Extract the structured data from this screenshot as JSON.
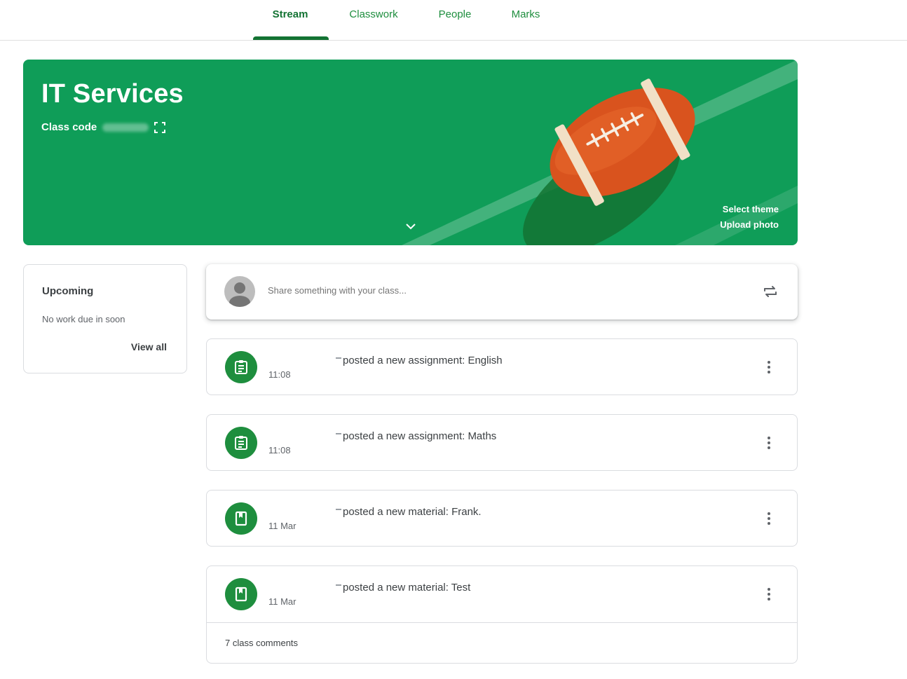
{
  "nav": {
    "tabs": [
      {
        "label": "Stream",
        "active": true
      },
      {
        "label": "Classwork",
        "active": false
      },
      {
        "label": "People",
        "active": false
      },
      {
        "label": "Marks",
        "active": false
      }
    ]
  },
  "banner": {
    "title": "IT Services",
    "class_code_label": "Class code",
    "select_theme": "Select theme",
    "upload_photo": "Upload photo",
    "color": "#0f9d58"
  },
  "upcoming": {
    "title": "Upcoming",
    "text": "No work due in soon",
    "view_all": "View all"
  },
  "share": {
    "placeholder": "Share something with your class..."
  },
  "posts": [
    {
      "title": "posted a new assignment: English",
      "time": "11:08",
      "icon": "assignment-icon"
    },
    {
      "title": "posted a new assignment: Maths",
      "time": "11:08",
      "icon": "assignment-icon"
    },
    {
      "title": "posted a new material: Frank.",
      "time": "11 Mar",
      "icon": "material-icon"
    },
    {
      "title": "posted a new material: Test",
      "time": "11 Mar",
      "icon": "material-icon",
      "comments": "7 class comments"
    }
  ],
  "colors": {
    "accent": "#1e8e3e",
    "accent_dark": "#137333"
  }
}
